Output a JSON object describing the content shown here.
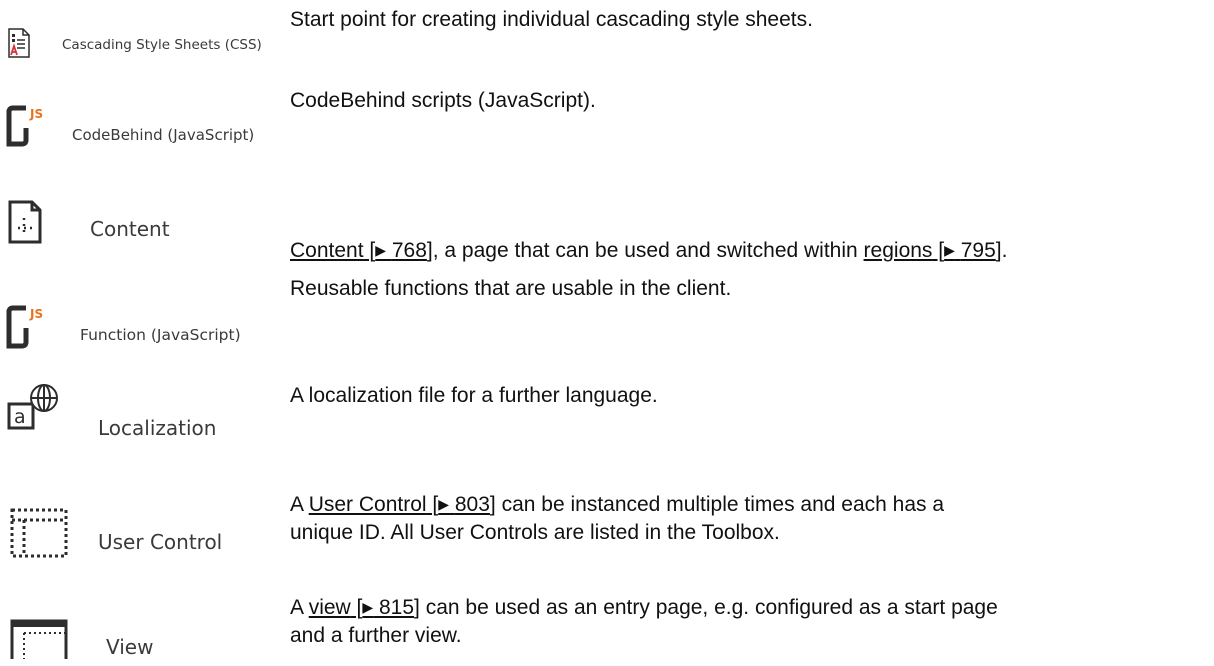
{
  "colors": {
    "text": "#111111",
    "label": "#3a3a3a",
    "icon_dark": "#2d2d2d",
    "icon_red": "#d0343a",
    "js_orange": "#e8731e"
  },
  "items": [
    {
      "label": "Cascading Style Sheets (CSS)",
      "icon": "css-file-icon",
      "description": [
        "Start point for creating individual cascading style sheets."
      ]
    },
    {
      "label": "CodeBehind (JavaScript)",
      "icon": "js-codebehind-icon",
      "icon_badge": "JS",
      "description": [
        "CodeBehind scripts (JavaScript)."
      ]
    },
    {
      "label": "Content",
      "icon": "content-page-icon",
      "description_parts": {
        "link1_text": "Content",
        "link1_arrow": "▶",
        "link1_page": "768",
        "middle": ", a page that can be used and switched within ",
        "link2_text": "regions",
        "link2_arrow": "▶",
        "link2_page": "795",
        "end": "."
      }
    },
    {
      "label": "Function (JavaScript)",
      "icon": "js-function-icon",
      "icon_badge": "JS",
      "description": [
        "Reusable functions that are usable in the client."
      ]
    },
    {
      "label": "Localization",
      "icon": "localization-globe-icon",
      "icon_letter": "a",
      "description": [
        "A localization file for a further language."
      ]
    },
    {
      "label": "User Control",
      "icon": "user-control-icon",
      "description_parts": {
        "start": "A ",
        "link_text": "User Control",
        "link_arrow": "▶",
        "link_page": "803",
        "rest_line1": " can be instanced multiple times and each has a",
        "line2": "unique ID. All User Controls are listed in the Toolbox."
      }
    },
    {
      "label": "View",
      "icon": "view-page-icon",
      "description_parts": {
        "start": "A ",
        "link_text": "view",
        "link_arrow": "▶",
        "link_page": "815",
        "rest_line1": " can be used as an entry page, e.g. configured as a start page",
        "line2": "and a further view."
      }
    }
  ]
}
